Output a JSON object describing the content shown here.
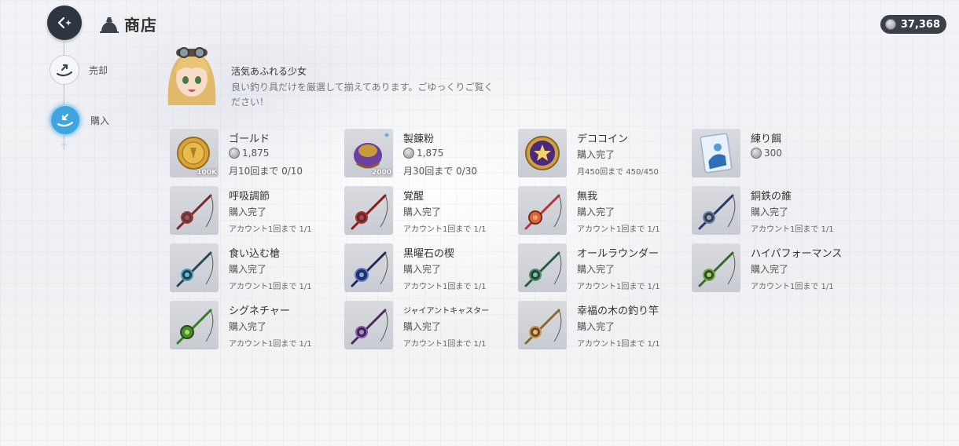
{
  "header": {
    "title": "商店",
    "currency_amount": "37,368"
  },
  "nav": {
    "sell_label": "売却",
    "buy_label": "購入"
  },
  "npc": {
    "name": "活気あふれる少女",
    "message": "良い釣り具だけを厳選して揃えてあります。ごゆっくりご覧ください！"
  },
  "items": [
    {
      "name": "ゴールド",
      "price": "1,875",
      "limit": "月10回まで 0/10",
      "qty_tag": "100K",
      "icon": "gold-coin-icon"
    },
    {
      "name": "製錬粉",
      "price": "1,875",
      "limit": "月30回まで 0/30",
      "qty_tag": "2000",
      "icon": "refining-powder-icon"
    },
    {
      "name": "デココイン",
      "status": "購入完了",
      "limit": "月450回まで 450/450",
      "icon": "deco-coin-icon"
    },
    {
      "name": "練り餌",
      "price": "300",
      "icon": "bait-pack-icon"
    },
    {
      "name": "呼吸調節",
      "status": "購入完了",
      "limit": "アカウント1回まで 1/1",
      "icon": "fishing-rod-icon"
    },
    {
      "name": "覚醒",
      "status": "購入完了",
      "limit": "アカウント1回まで 1/1",
      "icon": "fishing-rod-icon"
    },
    {
      "name": "無我",
      "status": "購入完了",
      "limit": "アカウント1回まで 1/1",
      "icon": "fishing-rod-icon"
    },
    {
      "name": "銅鉄の錐",
      "status": "購入完了",
      "limit": "アカウント1回まで 1/1",
      "icon": "fishing-rod-icon"
    },
    {
      "name": "食い込む槍",
      "status": "購入完了",
      "limit": "アカウント1回まで 1/1",
      "icon": "fishing-rod-icon"
    },
    {
      "name": "黒曜石の楔",
      "status": "購入完了",
      "limit": "アカウント1回まで 1/1",
      "icon": "fishing-rod-icon"
    },
    {
      "name": "オールラウンダー",
      "status": "購入完了",
      "limit": "アカウント1回まで 1/1",
      "icon": "fishing-rod-icon"
    },
    {
      "name": "ハイパフォーマンス",
      "status": "購入完了",
      "limit": "アカウント1回まで 1/1",
      "icon": "fishing-rod-icon"
    },
    {
      "name": "シグネチャー",
      "status": "購入完了",
      "limit": "アカウント1回まで 1/1",
      "icon": "fishing-rod-icon"
    },
    {
      "name": "ジャイアントキャスター",
      "status": "購入完了",
      "limit": "アカウント1回まで 1/1",
      "icon": "fishing-rod-icon"
    },
    {
      "name": "幸福の木の釣り竿",
      "status": "購入完了",
      "limit": "アカウント1回まで 1/1",
      "icon": "fishing-rod-icon"
    }
  ]
}
